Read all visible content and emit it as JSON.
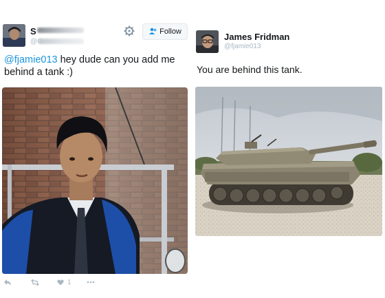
{
  "left_tweet": {
    "author_name": "S",
    "author_handle": "@G",
    "follow_label": "Follow",
    "text_mention": "@fjamie013",
    "text_body": " hey dude can you add me behind a tank :)",
    "likes_count": "1",
    "icons": [
      "gear-icon",
      "add-user-icon",
      "reply-icon",
      "retweet-icon",
      "heart-icon",
      "more-icon"
    ]
  },
  "right_tweet": {
    "author_name": "James Fridman",
    "author_handle": "@fjamie013",
    "text": "You are behind this tank."
  },
  "colors": {
    "link": "#1b95e0",
    "text": "#14171a",
    "muted": "#aab8c2",
    "button_bg": "#f5f8fa",
    "button_border": "#e1e8ed"
  }
}
